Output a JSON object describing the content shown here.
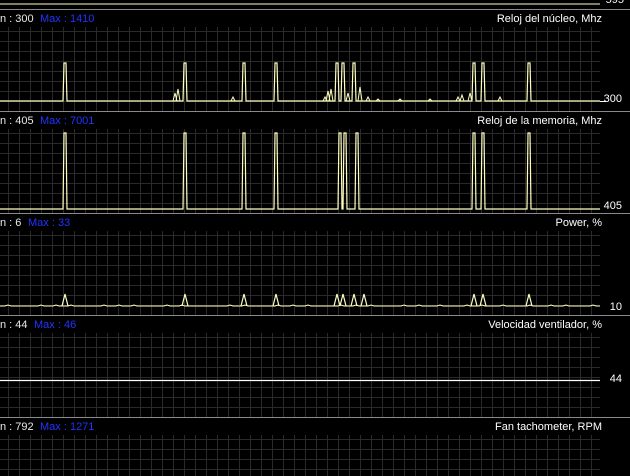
{
  "top_partial": {
    "value": "595"
  },
  "panels": [
    {
      "id": "core-clock",
      "min": "n : 300",
      "max": "Max : 1410",
      "title": "Reloj del núcleo, Mhz",
      "current": "300",
      "series": [
        0,
        0,
        0,
        0,
        0,
        0,
        0,
        0,
        0,
        0,
        0,
        0,
        0,
        1,
        1,
        0,
        0,
        0,
        0,
        0,
        0,
        0,
        0,
        0,
        0,
        0,
        0,
        0,
        0,
        0,
        0,
        0,
        0,
        0,
        0,
        0,
        0,
        0,
        0,
        0,
        0,
        0,
        0,
        0,
        0,
        0,
        0,
        0,
        0,
        0,
        0,
        0,
        0,
        0,
        0,
        0,
        0,
        0,
        12,
        30,
        100,
        30,
        5,
        0,
        0,
        0,
        0,
        0,
        0,
        0,
        0,
        0,
        0,
        0,
        0,
        0,
        0,
        0,
        0,
        0,
        0,
        0,
        0,
        0,
        0,
        0,
        0,
        0,
        0,
        0,
        0,
        0,
        0,
        0,
        0,
        0,
        0,
        0,
        0,
        0,
        0,
        0,
        0,
        0,
        0,
        0,
        0,
        0,
        0,
        0,
        0,
        0,
        0,
        0,
        0,
        0,
        0,
        0,
        0,
        0,
        0,
        0,
        0,
        0,
        0,
        0,
        0,
        0,
        0,
        0,
        0,
        0,
        0,
        0,
        0,
        0,
        0,
        0,
        0,
        0,
        0,
        0,
        0,
        0,
        0,
        0,
        0,
        0,
        0,
        0,
        0,
        0,
        0,
        0,
        0,
        0,
        0,
        0,
        0,
        0,
        0,
        0,
        0,
        0,
        0,
        0,
        0,
        0,
        0,
        0,
        0,
        0,
        0,
        0,
        0,
        0,
        0,
        0,
        0,
        0,
        0,
        0,
        0,
        0,
        0,
        0,
        0,
        0,
        0,
        0,
        0,
        0,
        0,
        0,
        0,
        0,
        0,
        0,
        0,
        0,
        0,
        0,
        0,
        0,
        0,
        0,
        0,
        0,
        0,
        0,
        0,
        0,
        0,
        0,
        0,
        0,
        0,
        0,
        0,
        0,
        0,
        0,
        0,
        0,
        0,
        0,
        0,
        0,
        0,
        0,
        0,
        0,
        0,
        0,
        0,
        0,
        0,
        0,
        0,
        0,
        0,
        0,
        0,
        0,
        0,
        0,
        0,
        0,
        0,
        0,
        0,
        0,
        0,
        0,
        0,
        0,
        0,
        0,
        0,
        0,
        0,
        0,
        0,
        0,
        0,
        0,
        0,
        0,
        0,
        0,
        0,
        0,
        0,
        0,
        0,
        0,
        0,
        0,
        0,
        0,
        0,
        0,
        0,
        0,
        0,
        0,
        0,
        0,
        0,
        0,
        0,
        0,
        0,
        0,
        0,
        0,
        0,
        0,
        0,
        0,
        0,
        0,
        0,
        0,
        0,
        0,
        0,
        0,
        0,
        0,
        0,
        0,
        0,
        0,
        0,
        0,
        0,
        0,
        0,
        0,
        0,
        0,
        0,
        0,
        0,
        0,
        0,
        0,
        0,
        0,
        0,
        0,
        0,
        0,
        0,
        0,
        0,
        0,
        0,
        0,
        0,
        0,
        0,
        0,
        0,
        0,
        0,
        0,
        0,
        0,
        0,
        0,
        0,
        0,
        0,
        0,
        0,
        0,
        0,
        0,
        0,
        0,
        0,
        0,
        0,
        0,
        0,
        0,
        0,
        0,
        0,
        0,
        0,
        0,
        0,
        0,
        0,
        0,
        0,
        0,
        0,
        0,
        0,
        0,
        0,
        0,
        0,
        0,
        0,
        0,
        0,
        0,
        0,
        0,
        0,
        0,
        0,
        0,
        0,
        0,
        0,
        0,
        0,
        0,
        0,
        0,
        0,
        0,
        0,
        0,
        0,
        0,
        0,
        0,
        0,
        0,
        0,
        0,
        0,
        0,
        0,
        0,
        0,
        0,
        0,
        0,
        0,
        0,
        0,
        0,
        0,
        0,
        0,
        0,
        0,
        0,
        0,
        0,
        0,
        0,
        0,
        0,
        0,
        0,
        0,
        0,
        0,
        0,
        0,
        0,
        0,
        0,
        0,
        0,
        0,
        0,
        0,
        0,
        0,
        0,
        0,
        0,
        0,
        0,
        0,
        0,
        0,
        0,
        0,
        0,
        0,
        0,
        0,
        0,
        0,
        0,
        0,
        0,
        0,
        0,
        0,
        0,
        0,
        0,
        0,
        0,
        0,
        0,
        0,
        0,
        0,
        0,
        0,
        0,
        0,
        0,
        0,
        0,
        0,
        0,
        0,
        0,
        0,
        0,
        0,
        0,
        0,
        0,
        0,
        0,
        0,
        0,
        0,
        0,
        0,
        0,
        0,
        0,
        0,
        0,
        0,
        0,
        0,
        0,
        0,
        0,
        0,
        0,
        0,
        0,
        0,
        0,
        0,
        0,
        0,
        0,
        0,
        0,
        0,
        0,
        0,
        0,
        0,
        0,
        0,
        0,
        0,
        0,
        0,
        0,
        0,
        0,
        0,
        0,
        0,
        0,
        0,
        0,
        0,
        0,
        0,
        0,
        0,
        0,
        0,
        0,
        0,
        0,
        0,
        0,
        0,
        0,
        0,
        0,
        0,
        0,
        0,
        0,
        0,
        0,
        0,
        0,
        0,
        0,
        0,
        0,
        0,
        0,
        0,
        0,
        0,
        0,
        0,
        0,
        0,
        0,
        0,
        0,
        0,
        0,
        0,
        0,
        0,
        0,
        0,
        0,
        0,
        0,
        0,
        0,
        0,
        0,
        0,
        0,
        0,
        0,
        0,
        0,
        0,
        0,
        0,
        0,
        0,
        0,
        0,
        0,
        0,
        0,
        0,
        0,
        0,
        0,
        0,
        0,
        0,
        0,
        0,
        0,
        0,
        0,
        0,
        0,
        0,
        0,
        0,
        0,
        0,
        0,
        0,
        0,
        0,
        0,
        0,
        0,
        0,
        0,
        0,
        0,
        0,
        0,
        0,
        0,
        0,
        0,
        0,
        0,
        0,
        0,
        0,
        0,
        0,
        0,
        0,
        0,
        0,
        0,
        0,
        0,
        0,
        0,
        0,
        0,
        0,
        0,
        0,
        0,
        0,
        0,
        0,
        0,
        0,
        0,
        0,
        0,
        0,
        0,
        0,
        0,
        0,
        0,
        0,
        0,
        0,
        0,
        0,
        0,
        0,
        0,
        0,
        0,
        0,
        0,
        0,
        0,
        0,
        0,
        0,
        0,
        0,
        0,
        0,
        0,
        0,
        0,
        0,
        0,
        0,
        0,
        0,
        0,
        0,
        0,
        0,
        0,
        0,
        0,
        0,
        0,
        0,
        0,
        0,
        0,
        0,
        0,
        0,
        0,
        0,
        0,
        0,
        0,
        0,
        0,
        0,
        0,
        0,
        0,
        0,
        0,
        0,
        0,
        0,
        0,
        0,
        0,
        0,
        0,
        0,
        0,
        0,
        0,
        0,
        0,
        0
      ]
    },
    {
      "id": "memory-clock",
      "min": "n : 405",
      "max": "Max : 7001",
      "title": "Reloj de la memoria, Mhz",
      "current": "405"
    },
    {
      "id": "power",
      "min": "n : 6",
      "max": "Max : 33",
      "title": "Power, %",
      "current": "10"
    },
    {
      "id": "fan-speed",
      "min": "n : 44",
      "max": "Max : 46",
      "title": "Velocidad ventilador, %",
      "current": "44"
    },
    {
      "id": "fan-tach",
      "min": "n : 792",
      "max": "Max : 1271",
      "title": "Fan tachometer, RPM",
      "current": ""
    }
  ],
  "colors": {
    "grid": "#2a2a2a",
    "trace": "#ffffc0",
    "label_max": "#2233ff",
    "divider": "#8a8a8a"
  }
}
